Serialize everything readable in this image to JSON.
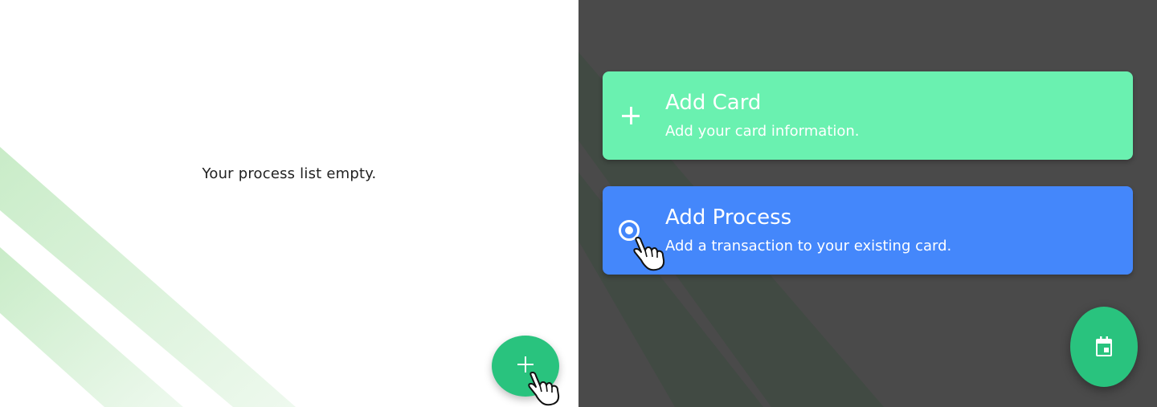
{
  "left_panel": {
    "empty_message": "Your process list empty.",
    "fab_icon": "plus-icon",
    "stripe_color": "#cdeecf"
  },
  "right_panel": {
    "background": "#4a4a4a",
    "menu": [
      {
        "title": "Add Card",
        "subtitle": "Add your card information.",
        "icon": "plus-icon",
        "color": "#6af1b0"
      },
      {
        "title": "Add Process",
        "subtitle": "Add a transaction to your existing card.",
        "icon": "radio-button-icon",
        "color": "#4487fb"
      }
    ],
    "fab_icon": "calendar-icon"
  },
  "colors": {
    "accent_green": "#29c37e"
  }
}
